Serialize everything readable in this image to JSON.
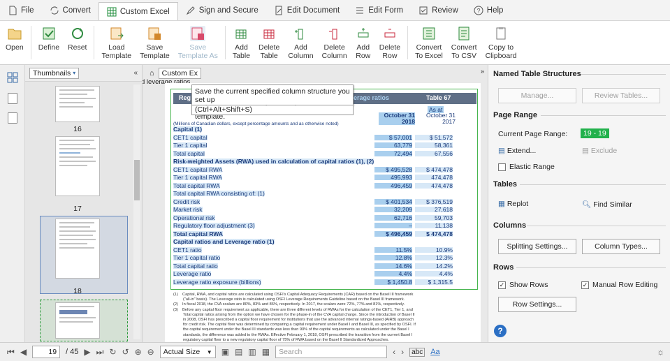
{
  "menu": {
    "items": [
      {
        "label": "File",
        "icon": "file-icon"
      },
      {
        "label": "Convert",
        "icon": "convert-icon"
      },
      {
        "label": "Custom Excel",
        "icon": "excel-grid-icon",
        "active": true
      },
      {
        "label": "Sign and Secure",
        "icon": "pen-icon"
      },
      {
        "label": "Edit Document",
        "icon": "edit-doc-icon"
      },
      {
        "label": "Edit Form",
        "icon": "form-icon"
      },
      {
        "label": "Review",
        "icon": "review-icon"
      },
      {
        "label": "Help",
        "icon": "help-icon"
      }
    ]
  },
  "ribbon": {
    "buttons": [
      {
        "label": "Open",
        "label2": "",
        "icon": "folder-icon"
      },
      {
        "label": "Define",
        "label2": "",
        "icon": "define-icon"
      },
      {
        "label": "Reset",
        "label2": "",
        "icon": "reset-icon"
      },
      {
        "label": "Load",
        "label2": "Template",
        "icon": "load-template-icon"
      },
      {
        "label": "Save",
        "label2": "Template",
        "icon": "save-template-icon"
      },
      {
        "label": "Save",
        "label2": "Template As",
        "icon": "save-template-as-icon"
      },
      {
        "label": "Add",
        "label2": "Table",
        "icon": "add-table-icon"
      },
      {
        "label": "Delete",
        "label2": "Table",
        "icon": "delete-table-icon"
      },
      {
        "label": "Add",
        "label2": "Column",
        "icon": "add-column-icon"
      },
      {
        "label": "Delete",
        "label2": "Column",
        "icon": "delete-column-icon"
      },
      {
        "label": "Add",
        "label2": "Row",
        "icon": "add-row-icon"
      },
      {
        "label": "Delete",
        "label2": "Row",
        "icon": "delete-row-icon"
      },
      {
        "label": "Convert",
        "label2": "To Excel",
        "icon": "to-excel-icon"
      },
      {
        "label": "Convert",
        "label2": "To CSV",
        "icon": "to-csv-icon"
      },
      {
        "label": "Copy to",
        "label2": "Clipboard",
        "icon": "clipboard-icon"
      }
    ]
  },
  "thumbnails": {
    "dropdown_label": "Thumbnails",
    "pages": [
      {
        "label": "16"
      },
      {
        "label": "17"
      },
      {
        "label": "18"
      }
    ]
  },
  "doc": {
    "tab_label": "Custom Ex",
    "tooltip": {
      "line1": "Save the current specified column structure you set up",
      "line2": "during a custom Excel conversion as a template.",
      "shortcut": "(Ctrl+Alt+Shift+S)"
    },
    "side_text": "d leverage ratios",
    "table_header_left": "Reg",
    "table_header_mid": "erage ratios",
    "table_header_right": "Table 67",
    "as_at": "As at",
    "col1_head1": "October 31",
    "col1_head2": "2018",
    "col2_head1": "October 31",
    "col2_head2": "2017",
    "units_note": "(Millions of Canadian dollars, except percentage amounts and as otherwise noted)",
    "rows": [
      {
        "label": "Capital (1)",
        "v1": "",
        "v2": "",
        "bold": true
      },
      {
        "label": "CET1 capital",
        "v1": "$     57,001",
        "v2": "$     51,572"
      },
      {
        "label": "Tier 1 capital",
        "v1": "63,779",
        "v2": "58,361"
      },
      {
        "label": "Total capital",
        "v1": "72,494",
        "v2": "67,556"
      },
      {
        "label": "Risk-weighted Assets (RWA) used in calculation of capital ratios (1), (2)",
        "v1": "",
        "v2": "",
        "bold": true
      },
      {
        "label": "CET1 capital RWA",
        "v1": "$   495,528",
        "v2": "$   474,478"
      },
      {
        "label": "Tier 1 capital RWA",
        "v1": "495,993",
        "v2": "474,478"
      },
      {
        "label": "Total capital RWA",
        "v1": "496,459",
        "v2": "474,478"
      },
      {
        "label": "Total capital RWA consisting of: (1)",
        "v1": "",
        "v2": ""
      },
      {
        "label": "Credit risk",
        "v1": "$   401,534",
        "v2": "$   376,519"
      },
      {
        "label": "Market risk",
        "v1": "32,209",
        "v2": "27,618"
      },
      {
        "label": "Operational risk",
        "v1": "62,716",
        "v2": "59,703"
      },
      {
        "label": "Regulatory floor adjustment (3)",
        "v1": "–",
        "v2": "11,138"
      },
      {
        "label": "Total capital RWA",
        "v1": "$   496,459",
        "v2": "$   474,478",
        "bold": true
      },
      {
        "label": "Capital ratios and Leverage ratio (1)",
        "v1": "",
        "v2": "",
        "bold": true
      },
      {
        "label": "CET1 ratio",
        "v1": "11.5%",
        "v2": "10.9%"
      },
      {
        "label": "Tier 1 capital ratio",
        "v1": "12.8%",
        "v2": "12.3%"
      },
      {
        "label": "Total capital ratio",
        "v1": "14.6%",
        "v2": "14.2%"
      },
      {
        "label": "Leverage ratio",
        "v1": "4.4%",
        "v2": "4.4%"
      },
      {
        "label": "Leverage ratio exposure (billions)",
        "v1": "$   1,450.8",
        "v2": "$   1,315.5"
      }
    ],
    "footnotes": [
      "(1)    Capital, RWA, and capital ratios are calculated using OSFI's Capital Adequacy Requirements (CAR) based on the Basel III framework",
      "         (\"all-in\" basis). The Leverage ratio is calculated using OSFI Leverage Requirements Guideline based on the Basel III framework.",
      "(2)    In fiscal 2018, the CVA scalars are 80%, 83% and 86%, respectively. In 2017, the scalars were 72%, 77% and 81%, respectively.",
      "(3)    Before any capital floor requirement as applicable, there are three different levels of RWAs for the calculation of the CET1, Tier 1, and",
      "         Total capital ratios arising from the option we have chosen for the phase-in of the CVA capital charge. Since the introduction of Basel II",
      "         in 2008, OSFI has prescribed a capital floor requirement for institutions that use the advanced internal ratings-based (AIRB) approach",
      "         for credit risk. The capital floor was determined by comparing a capital requirement under Basel I and Basel III, as specified by OSFI. If",
      "         the capital requirement under the Basel III standards was less than 90% of the capital requirements as calculated under the Basel I",
      "         standards, the difference was added to the RWAs. Effective February 1, 2018, OSFI prescribed the transition from the current Basel I",
      "         regulatory capital floor to a new regulatory capital floor of 75% of RWA based on the Basel II Standardized Approaches."
    ]
  },
  "right_panel": {
    "named_tables": {
      "title": "Named Table Structures",
      "manage": "Manage...",
      "review": "Review Tables..."
    },
    "page_range": {
      "title": "Page Range",
      "current_label": "Current Page Range:",
      "current_value": "19 - 19",
      "extend": "Extend...",
      "exclude": "Exclude",
      "elastic": "Elastic Range"
    },
    "tables": {
      "title": "Tables",
      "replot": "Replot",
      "find_similar": "Find Similar"
    },
    "columns": {
      "title": "Columns",
      "splitting": "Splitting Settings...",
      "types": "Column Types..."
    },
    "rows": {
      "title": "Rows",
      "show_rows": "Show Rows",
      "manual": "Manual Row Editing",
      "settings": "Row Settings..."
    }
  },
  "bottom": {
    "page_current": "19",
    "page_total": "/ 45",
    "zoom": "Actual Size",
    "search_placeholder": "Search",
    "abc_label": "abc",
    "aa_label": "Aa"
  },
  "colors": {
    "accent_green": "#22b14c",
    "table_highlight": "#a9cfee",
    "table_header": "#5f6f86"
  }
}
